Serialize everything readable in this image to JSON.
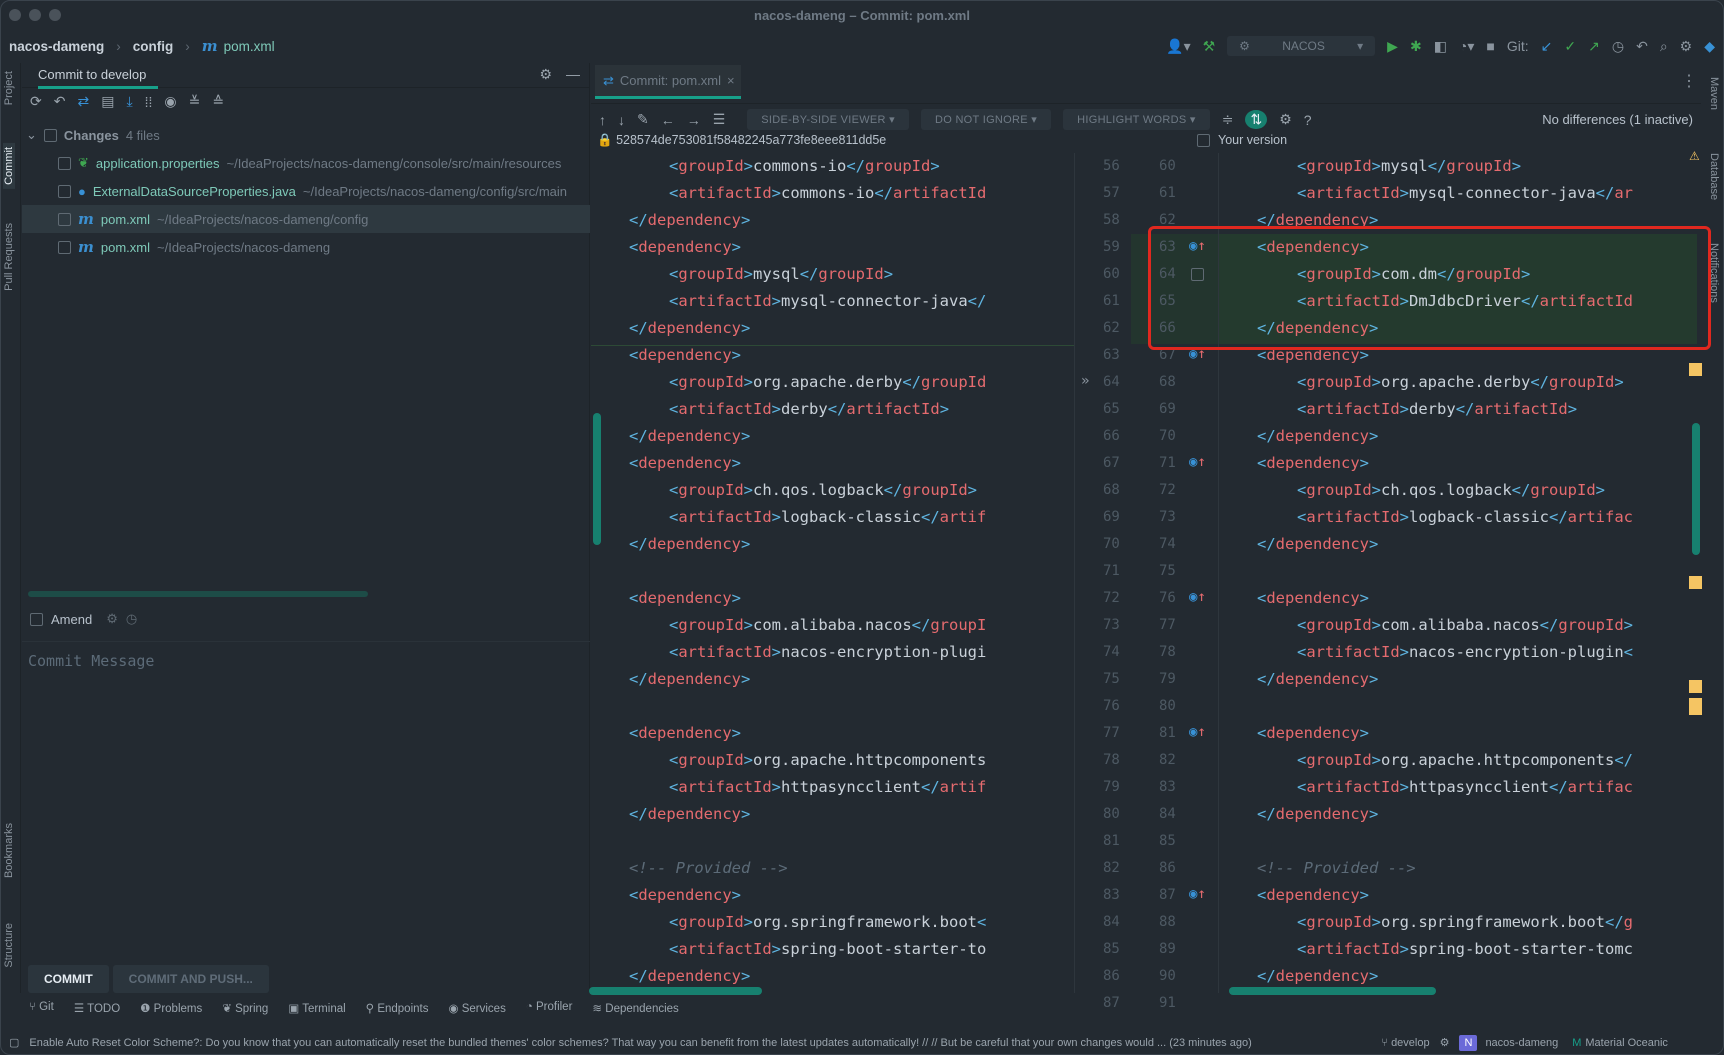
{
  "window": {
    "title": "nacos-dameng – Commit: pom.xml"
  },
  "breadcrumb": {
    "project": "nacos-dameng",
    "module": "config",
    "file": "pom.xml"
  },
  "toolbar": {
    "run_config": "NACOS",
    "git_label": "Git:"
  },
  "left_strip": [
    "Project",
    "Commit",
    "Pull Requests",
    "Bookmarks",
    "Structure"
  ],
  "right_strip": [
    "Maven",
    "Database",
    "Notifications"
  ],
  "commit_panel": {
    "tab_label": "Commit to develop",
    "changes_label": "Changes",
    "changes_count": "4 files",
    "files": [
      {
        "name": "application.properties",
        "path": "~/IdeaProjects/nacos-dameng/console/src/main/resources",
        "icon": "spring-properties-icon",
        "selected": false
      },
      {
        "name": "ExternalDataSourceProperties.java",
        "path": "~/IdeaProjects/nacos-dameng/config/src/main",
        "icon": "java-class-icon",
        "selected": false
      },
      {
        "name": "pom.xml",
        "path": "~/IdeaProjects/nacos-dameng/config",
        "icon": "maven-icon",
        "selected": true
      },
      {
        "name": "pom.xml",
        "path": "~/IdeaProjects/nacos-dameng",
        "icon": "maven-icon",
        "selected": false
      }
    ],
    "amend_label": "Amend",
    "commit_message_placeholder": "Commit Message",
    "commit_button": "COMMIT",
    "commit_push_button": "COMMIT AND PUSH..."
  },
  "editor": {
    "tab_label": "Commit: pom.xml",
    "viewer_mode": "SIDE-BY-SIDE VIEWER",
    "ignore_mode": "DO NOT IGNORE",
    "highlight_mode": "HIGHLIGHT WORDS",
    "status": "No differences (1 inactive)",
    "left_revision": "528574de753081f58482245a773fe8eee811dd5e",
    "right_label": "Your version",
    "left_lines": [
      {
        "n": "56",
        "i": 2,
        "tag": "groupId",
        "val": "commons-io",
        "end": "</groupId>"
      },
      {
        "n": "57",
        "i": 2,
        "tag": "artifactId",
        "val": "commons-io",
        "end": "</artifactId"
      },
      {
        "n": "58",
        "i": 1,
        "close": "dependency"
      },
      {
        "n": "59",
        "i": 1,
        "open": "dependency"
      },
      {
        "n": "60",
        "i": 2,
        "tag": "groupId",
        "val": "mysql",
        "end": "</groupId>"
      },
      {
        "n": "61",
        "i": 2,
        "tag": "artifactId",
        "val": "mysql-connector-java",
        "end": "</"
      },
      {
        "n": "62",
        "i": 1,
        "close": "dependency"
      },
      {
        "n": "63",
        "i": 1,
        "open": "dependency"
      },
      {
        "n": "64",
        "i": 2,
        "tag": "groupId",
        "val": "org.apache.derby",
        "end": "</groupId"
      },
      {
        "n": "65",
        "i": 2,
        "tag": "artifactId",
        "val": "derby",
        "end": "</artifactId>"
      },
      {
        "n": "66",
        "i": 1,
        "close": "dependency"
      },
      {
        "n": "67",
        "i": 1,
        "open": "dependency"
      },
      {
        "n": "68",
        "i": 2,
        "tag": "groupId",
        "val": "ch.qos.logback",
        "end": "</groupId>"
      },
      {
        "n": "69",
        "i": 2,
        "tag": "artifactId",
        "val": "logback-classic",
        "end": "</artif"
      },
      {
        "n": "70",
        "i": 1,
        "close": "dependency"
      },
      {
        "n": "71",
        "blank": true
      },
      {
        "n": "72",
        "i": 1,
        "open": "dependency"
      },
      {
        "n": "73",
        "i": 2,
        "tag": "groupId",
        "val": "com.alibaba.nacos",
        "end": "</groupI"
      },
      {
        "n": "74",
        "i": 2,
        "tag": "artifactId",
        "val": "nacos-encryption-plugi",
        "end": ""
      },
      {
        "n": "75",
        "i": 1,
        "close": "dependency"
      },
      {
        "n": "76",
        "blank": true
      },
      {
        "n": "77",
        "i": 1,
        "open": "dependency"
      },
      {
        "n": "78",
        "i": 2,
        "tag": "groupId",
        "val": "org.apache.httpcomponents",
        "end": ""
      },
      {
        "n": "79",
        "i": 2,
        "tag": "artifactId",
        "val": "httpasyncclient",
        "end": "</artif"
      },
      {
        "n": "80",
        "i": 1,
        "close": "dependency"
      },
      {
        "n": "81",
        "blank": true
      },
      {
        "n": "82",
        "i": 1,
        "comment": "<!-- Provided -->"
      },
      {
        "n": "83",
        "i": 1,
        "open": "dependency"
      },
      {
        "n": "84",
        "i": 2,
        "tag": "groupId",
        "val": "org.springframework.boot",
        "end": "<"
      },
      {
        "n": "85",
        "i": 2,
        "tag": "artifactId",
        "val": "spring-boot-starter-to",
        "end": ""
      },
      {
        "n": "86",
        "i": 1,
        "close": "dependency"
      },
      {
        "n": "87",
        "blank": true
      }
    ],
    "right_lines": [
      {
        "n": "60",
        "i": 2,
        "tag": "groupId",
        "val": "mysql",
        "end": "</groupId>"
      },
      {
        "n": "61",
        "i": 2,
        "tag": "artifactId",
        "val": "mysql-connector-java",
        "end": "</ar"
      },
      {
        "n": "62",
        "i": 1,
        "close": "dependency"
      },
      {
        "n": "63",
        "i": 1,
        "open": "dependency"
      },
      {
        "n": "64",
        "i": 2,
        "tag": "groupId",
        "val": "com.dm",
        "end": "</groupId>"
      },
      {
        "n": "65",
        "i": 2,
        "tag": "artifactId",
        "val": "DmJdbcDriver",
        "end": "</artifactId"
      },
      {
        "n": "66",
        "i": 1,
        "close": "dependency"
      },
      {
        "n": "67",
        "i": 1,
        "open": "dependency"
      },
      {
        "n": "68",
        "i": 2,
        "tag": "groupId",
        "val": "org.apache.derby",
        "end": "</groupId>"
      },
      {
        "n": "69",
        "i": 2,
        "tag": "artifactId",
        "val": "derby",
        "end": "</artifactId>"
      },
      {
        "n": "70",
        "i": 1,
        "close": "dependency"
      },
      {
        "n": "71",
        "i": 1,
        "open": "dependency"
      },
      {
        "n": "72",
        "i": 2,
        "tag": "groupId",
        "val": "ch.qos.logback",
        "end": "</groupId>"
      },
      {
        "n": "73",
        "i": 2,
        "tag": "artifactId",
        "val": "logback-classic",
        "end": "</artifac"
      },
      {
        "n": "74",
        "i": 1,
        "close": "dependency"
      },
      {
        "n": "75",
        "blank": true
      },
      {
        "n": "76",
        "i": 1,
        "open": "dependency"
      },
      {
        "n": "77",
        "i": 2,
        "tag": "groupId",
        "val": "com.alibaba.nacos",
        "end": "</groupId>"
      },
      {
        "n": "78",
        "i": 2,
        "tag": "artifactId",
        "val": "nacos-encryption-plugin",
        "end": "<"
      },
      {
        "n": "79",
        "i": 1,
        "close": "dependency"
      },
      {
        "n": "80",
        "blank": true
      },
      {
        "n": "81",
        "i": 1,
        "open": "dependency"
      },
      {
        "n": "82",
        "i": 2,
        "tag": "groupId",
        "val": "org.apache.httpcomponents",
        "end": "</"
      },
      {
        "n": "83",
        "i": 2,
        "tag": "artifactId",
        "val": "httpasyncclient",
        "end": "</artifac"
      },
      {
        "n": "84",
        "i": 1,
        "close": "dependency"
      },
      {
        "n": "85",
        "blank": true
      },
      {
        "n": "86",
        "i": 1,
        "comment": "<!-- Provided -->"
      },
      {
        "n": "87",
        "i": 1,
        "open": "dependency"
      },
      {
        "n": "88",
        "i": 2,
        "tag": "groupId",
        "val": "org.springframework.boot",
        "end": "</g"
      },
      {
        "n": "89",
        "i": 2,
        "tag": "artifactId",
        "val": "spring-boot-starter-tomc",
        "end": ""
      },
      {
        "n": "90",
        "i": 1,
        "close": "dependency"
      },
      {
        "n": "91",
        "blank": true
      }
    ]
  },
  "bottom_tabs": [
    "Git",
    "TODO",
    "Problems",
    "Spring",
    "Terminal",
    "Endpoints",
    "Services",
    "Profiler",
    "Dependencies"
  ],
  "status_bar": {
    "message": "Enable Auto Reset Color Scheme?: Do you know that you can automatically reset the bundled themes' color schemes? That way you can benefit from the latest updates automatically! // // But be careful that your own changes would ... (23 minutes ago)",
    "branch": "develop",
    "project_badge": "N",
    "project": "nacos-dameng",
    "theme": "Material Oceanic"
  },
  "colors": {
    "accent": "#17a08a",
    "added_bg": "#243a2e",
    "highlight_box": "#e0281f",
    "tag_name": "#e56b6f",
    "bracket": "#5fb4e0"
  }
}
